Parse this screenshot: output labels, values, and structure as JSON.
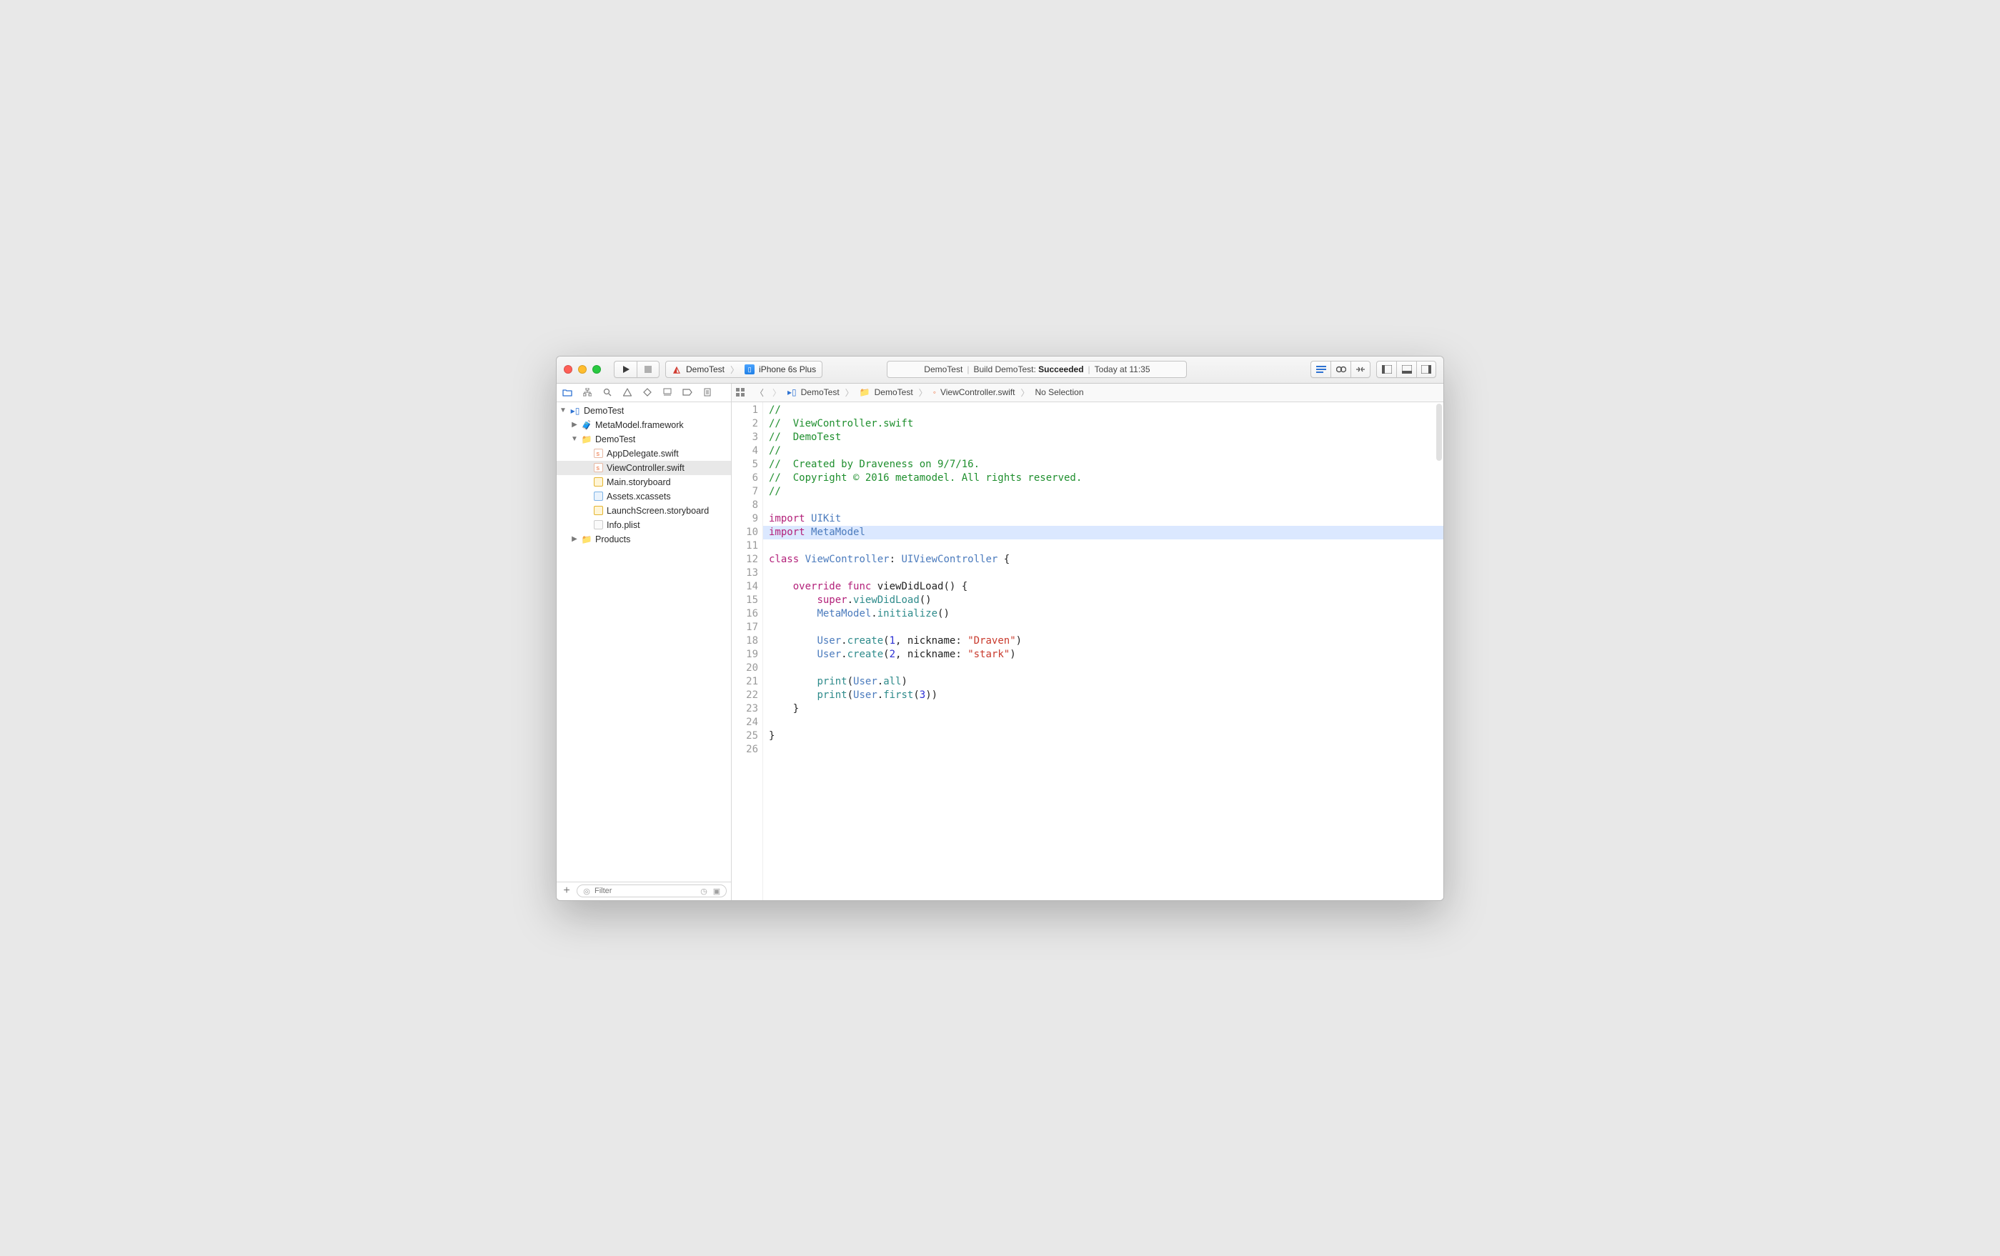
{
  "toolbar": {
    "scheme": {
      "target": "DemoTest",
      "device": "iPhone 6s Plus"
    },
    "activity": {
      "project": "DemoTest",
      "action_prefix": "Build DemoTest:",
      "action_status": "Succeeded",
      "timestamp": "Today at 11:35"
    }
  },
  "navigator": {
    "root": "DemoTest",
    "nodes": [
      {
        "label": "MetaModel.framework",
        "indent": 1,
        "kind": "briefcase",
        "disclosure": "closed"
      },
      {
        "label": "DemoTest",
        "indent": 1,
        "kind": "folder",
        "disclosure": "open"
      },
      {
        "label": "AppDelegate.swift",
        "indent": 2,
        "kind": "swift"
      },
      {
        "label": "ViewController.swift",
        "indent": 2,
        "kind": "swift",
        "selected": true
      },
      {
        "label": "Main.storyboard",
        "indent": 2,
        "kind": "storyboard"
      },
      {
        "label": "Assets.xcassets",
        "indent": 2,
        "kind": "xcassets"
      },
      {
        "label": "LaunchScreen.storyboard",
        "indent": 2,
        "kind": "storyboard"
      },
      {
        "label": "Info.plist",
        "indent": 2,
        "kind": "plist"
      },
      {
        "label": "Products",
        "indent": 1,
        "kind": "folder",
        "disclosure": "closed"
      }
    ],
    "filter_placeholder": "Filter"
  },
  "jumpbar": {
    "segments": [
      "DemoTest",
      "DemoTest",
      "ViewController.swift",
      "No Selection"
    ]
  },
  "code": {
    "lines": [
      [
        [
          "comment",
          "//"
        ]
      ],
      [
        [
          "comment",
          "//  ViewController.swift"
        ]
      ],
      [
        [
          "comment",
          "//  DemoTest"
        ]
      ],
      [
        [
          "comment",
          "//"
        ]
      ],
      [
        [
          "comment",
          "//  Created by Draveness on 9/7/16."
        ]
      ],
      [
        [
          "comment",
          "//  Copyright © 2016 metamodel. All rights reserved."
        ]
      ],
      [
        [
          "comment",
          "//"
        ]
      ],
      [],
      [
        [
          "keyword",
          "import"
        ],
        [
          "plain",
          " "
        ],
        [
          "type",
          "UIKit"
        ]
      ],
      [
        [
          "keyword",
          "import"
        ],
        [
          "plain",
          " "
        ],
        [
          "type",
          "MetaModel"
        ]
      ],
      [],
      [
        [
          "keyword",
          "class"
        ],
        [
          "plain",
          " "
        ],
        [
          "type",
          "ViewController"
        ],
        [
          "plain",
          ": "
        ],
        [
          "type",
          "UIViewController"
        ],
        [
          "plain",
          " {"
        ]
      ],
      [],
      [
        [
          "plain",
          "    "
        ],
        [
          "keyword",
          "override"
        ],
        [
          "plain",
          " "
        ],
        [
          "keyword",
          "func"
        ],
        [
          "plain",
          " "
        ],
        [
          "plain",
          "viewDidLoad() {"
        ]
      ],
      [
        [
          "plain",
          "        "
        ],
        [
          "keyword",
          "super"
        ],
        [
          "plain",
          "."
        ],
        [
          "func",
          "viewDidLoad"
        ],
        [
          "plain",
          "()"
        ]
      ],
      [
        [
          "plain",
          "        "
        ],
        [
          "type",
          "MetaModel"
        ],
        [
          "plain",
          "."
        ],
        [
          "func",
          "initialize"
        ],
        [
          "plain",
          "()"
        ]
      ],
      [],
      [
        [
          "plain",
          "        "
        ],
        [
          "type",
          "User"
        ],
        [
          "plain",
          "."
        ],
        [
          "func",
          "create"
        ],
        [
          "plain",
          "("
        ],
        [
          "number",
          "1"
        ],
        [
          "plain",
          ", nickname: "
        ],
        [
          "string",
          "\"Draven\""
        ],
        [
          "plain",
          ")"
        ]
      ],
      [
        [
          "plain",
          "        "
        ],
        [
          "type",
          "User"
        ],
        [
          "plain",
          "."
        ],
        [
          "func",
          "create"
        ],
        [
          "plain",
          "("
        ],
        [
          "number",
          "2"
        ],
        [
          "plain",
          ", nickname: "
        ],
        [
          "string",
          "\"stark\""
        ],
        [
          "plain",
          ")"
        ]
      ],
      [],
      [
        [
          "plain",
          "        "
        ],
        [
          "func",
          "print"
        ],
        [
          "plain",
          "("
        ],
        [
          "type",
          "User"
        ],
        [
          "plain",
          "."
        ],
        [
          "func",
          "all"
        ],
        [
          "plain",
          ")"
        ]
      ],
      [
        [
          "plain",
          "        "
        ],
        [
          "func",
          "print"
        ],
        [
          "plain",
          "("
        ],
        [
          "type",
          "User"
        ],
        [
          "plain",
          "."
        ],
        [
          "func",
          "first"
        ],
        [
          "plain",
          "("
        ],
        [
          "number",
          "3"
        ],
        [
          "plain",
          "))"
        ]
      ],
      [
        [
          "plain",
          "    }"
        ]
      ],
      [],
      [
        [
          "plain",
          "}"
        ]
      ],
      []
    ],
    "highlighted_line": 10
  }
}
